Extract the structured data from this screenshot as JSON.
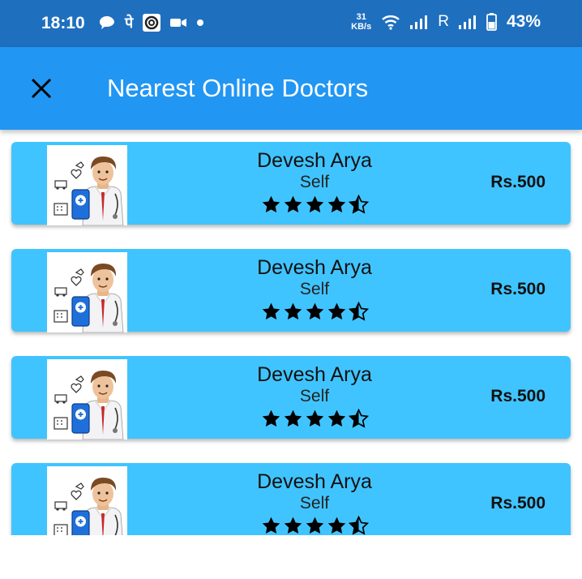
{
  "status_bar": {
    "time": "18:10",
    "hindi_char": "पे",
    "net_speed_value": "31",
    "net_speed_unit": "KB/s",
    "roaming": "R",
    "battery_percent": "43%"
  },
  "app_bar": {
    "title": "Nearest Online Doctors",
    "close_icon": "close-icon"
  },
  "doctors": [
    {
      "name": "Devesh Arya",
      "type": "Self",
      "rating": 4.5,
      "price": "Rs.500"
    },
    {
      "name": "Devesh Arya",
      "type": "Self",
      "rating": 4.5,
      "price": "Rs.500"
    },
    {
      "name": "Devesh Arya",
      "type": "Self",
      "rating": 4.5,
      "price": "Rs.500"
    },
    {
      "name": "Devesh Arya",
      "type": "Self",
      "rating": 4.5,
      "price": "Rs.500"
    }
  ],
  "colors": {
    "status_bar": "#1f6fbf",
    "app_bar": "#2196f3",
    "card": "#40c4ff"
  }
}
